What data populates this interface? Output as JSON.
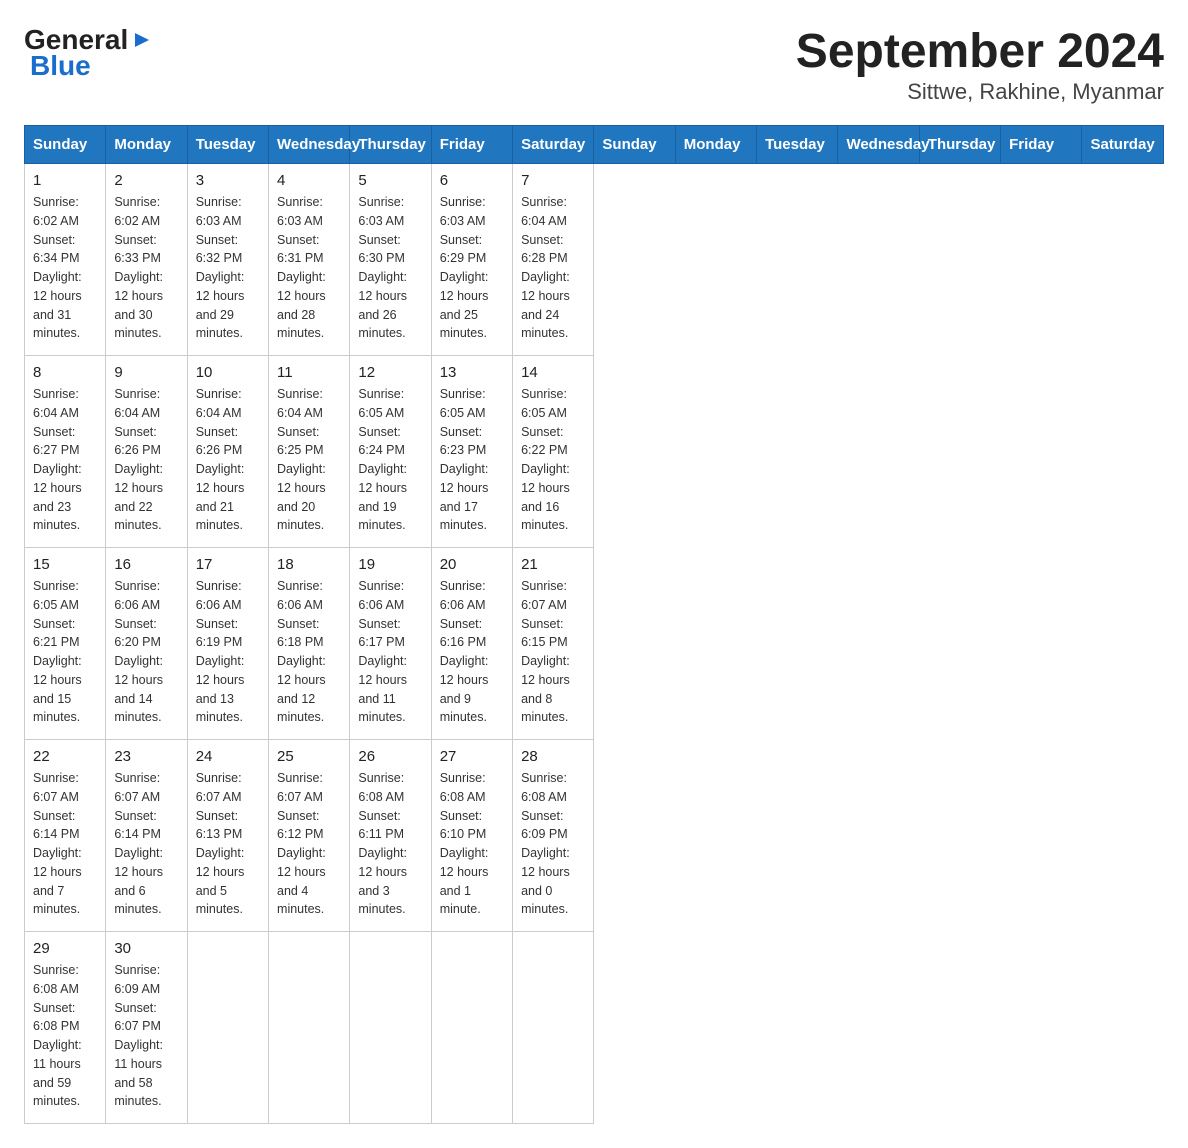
{
  "header": {
    "title": "September 2024",
    "subtitle": "Sittwe, Rakhine, Myanmar"
  },
  "logo": {
    "general": "General",
    "blue": "Blue"
  },
  "days_of_week": [
    "Sunday",
    "Monday",
    "Tuesday",
    "Wednesday",
    "Thursday",
    "Friday",
    "Saturday"
  ],
  "weeks": [
    [
      {
        "day": "1",
        "sunrise": "6:02 AM",
        "sunset": "6:34 PM",
        "daylight": "12 hours and 31 minutes."
      },
      {
        "day": "2",
        "sunrise": "6:02 AM",
        "sunset": "6:33 PM",
        "daylight": "12 hours and 30 minutes."
      },
      {
        "day": "3",
        "sunrise": "6:03 AM",
        "sunset": "6:32 PM",
        "daylight": "12 hours and 29 minutes."
      },
      {
        "day": "4",
        "sunrise": "6:03 AM",
        "sunset": "6:31 PM",
        "daylight": "12 hours and 28 minutes."
      },
      {
        "day": "5",
        "sunrise": "6:03 AM",
        "sunset": "6:30 PM",
        "daylight": "12 hours and 26 minutes."
      },
      {
        "day": "6",
        "sunrise": "6:03 AM",
        "sunset": "6:29 PM",
        "daylight": "12 hours and 25 minutes."
      },
      {
        "day": "7",
        "sunrise": "6:04 AM",
        "sunset": "6:28 PM",
        "daylight": "12 hours and 24 minutes."
      }
    ],
    [
      {
        "day": "8",
        "sunrise": "6:04 AM",
        "sunset": "6:27 PM",
        "daylight": "12 hours and 23 minutes."
      },
      {
        "day": "9",
        "sunrise": "6:04 AM",
        "sunset": "6:26 PM",
        "daylight": "12 hours and 22 minutes."
      },
      {
        "day": "10",
        "sunrise": "6:04 AM",
        "sunset": "6:26 PM",
        "daylight": "12 hours and 21 minutes."
      },
      {
        "day": "11",
        "sunrise": "6:04 AM",
        "sunset": "6:25 PM",
        "daylight": "12 hours and 20 minutes."
      },
      {
        "day": "12",
        "sunrise": "6:05 AM",
        "sunset": "6:24 PM",
        "daylight": "12 hours and 19 minutes."
      },
      {
        "day": "13",
        "sunrise": "6:05 AM",
        "sunset": "6:23 PM",
        "daylight": "12 hours and 17 minutes."
      },
      {
        "day": "14",
        "sunrise": "6:05 AM",
        "sunset": "6:22 PM",
        "daylight": "12 hours and 16 minutes."
      }
    ],
    [
      {
        "day": "15",
        "sunrise": "6:05 AM",
        "sunset": "6:21 PM",
        "daylight": "12 hours and 15 minutes."
      },
      {
        "day": "16",
        "sunrise": "6:06 AM",
        "sunset": "6:20 PM",
        "daylight": "12 hours and 14 minutes."
      },
      {
        "day": "17",
        "sunrise": "6:06 AM",
        "sunset": "6:19 PM",
        "daylight": "12 hours and 13 minutes."
      },
      {
        "day": "18",
        "sunrise": "6:06 AM",
        "sunset": "6:18 PM",
        "daylight": "12 hours and 12 minutes."
      },
      {
        "day": "19",
        "sunrise": "6:06 AM",
        "sunset": "6:17 PM",
        "daylight": "12 hours and 11 minutes."
      },
      {
        "day": "20",
        "sunrise": "6:06 AM",
        "sunset": "6:16 PM",
        "daylight": "12 hours and 9 minutes."
      },
      {
        "day": "21",
        "sunrise": "6:07 AM",
        "sunset": "6:15 PM",
        "daylight": "12 hours and 8 minutes."
      }
    ],
    [
      {
        "day": "22",
        "sunrise": "6:07 AM",
        "sunset": "6:14 PM",
        "daylight": "12 hours and 7 minutes."
      },
      {
        "day": "23",
        "sunrise": "6:07 AM",
        "sunset": "6:14 PM",
        "daylight": "12 hours and 6 minutes."
      },
      {
        "day": "24",
        "sunrise": "6:07 AM",
        "sunset": "6:13 PM",
        "daylight": "12 hours and 5 minutes."
      },
      {
        "day": "25",
        "sunrise": "6:07 AM",
        "sunset": "6:12 PM",
        "daylight": "12 hours and 4 minutes."
      },
      {
        "day": "26",
        "sunrise": "6:08 AM",
        "sunset": "6:11 PM",
        "daylight": "12 hours and 3 minutes."
      },
      {
        "day": "27",
        "sunrise": "6:08 AM",
        "sunset": "6:10 PM",
        "daylight": "12 hours and 1 minute."
      },
      {
        "day": "28",
        "sunrise": "6:08 AM",
        "sunset": "6:09 PM",
        "daylight": "12 hours and 0 minutes."
      }
    ],
    [
      {
        "day": "29",
        "sunrise": "6:08 AM",
        "sunset": "6:08 PM",
        "daylight": "11 hours and 59 minutes."
      },
      {
        "day": "30",
        "sunrise": "6:09 AM",
        "sunset": "6:07 PM",
        "daylight": "11 hours and 58 minutes."
      },
      null,
      null,
      null,
      null,
      null
    ]
  ],
  "labels": {
    "sunrise": "Sunrise:",
    "sunset": "Sunset:",
    "daylight": "Daylight:"
  }
}
